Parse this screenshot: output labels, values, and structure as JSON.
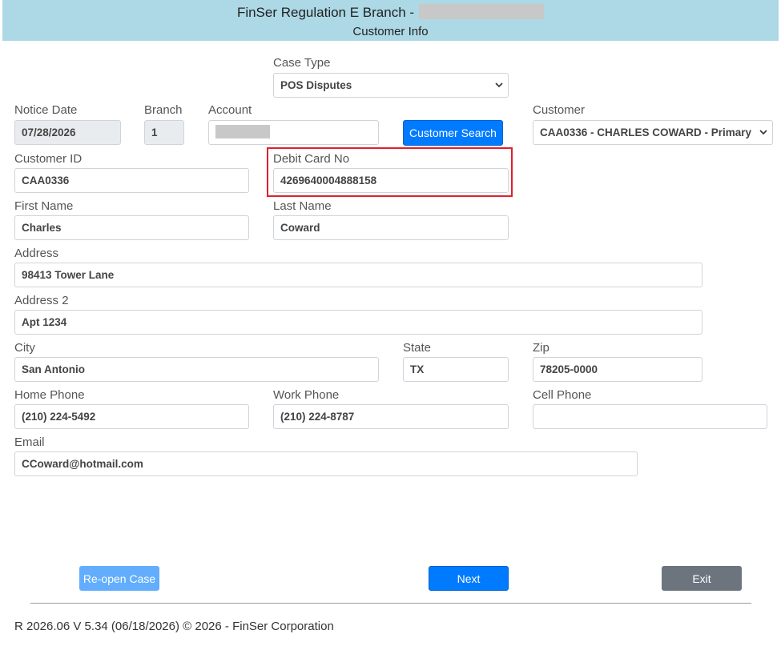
{
  "header": {
    "title": "FinSer Regulation E Branch -",
    "subtitle": "Customer Info"
  },
  "form": {
    "case_type": {
      "label": "Case Type",
      "value": "POS Disputes"
    },
    "notice_date": {
      "label": "Notice Date",
      "value": "07/28/2026"
    },
    "branch": {
      "label": "Branch",
      "value": "1"
    },
    "account": {
      "label": "Account",
      "value": ""
    },
    "customer_search_label": "Customer Search",
    "customer": {
      "label": "Customer",
      "value": "CAA0336 - CHARLES COWARD - Primary"
    },
    "customer_id": {
      "label": "Customer ID",
      "value": "CAA0336"
    },
    "debit_card": {
      "label": "Debit Card No",
      "value": "4269640004888158"
    },
    "first_name": {
      "label": "First Name",
      "value": "Charles"
    },
    "last_name": {
      "label": "Last Name",
      "value": "Coward"
    },
    "address": {
      "label": "Address",
      "value": "98413 Tower Lane"
    },
    "address2": {
      "label": "Address 2",
      "value": "Apt 1234"
    },
    "city": {
      "label": "City",
      "value": "San Antonio"
    },
    "state": {
      "label": "State",
      "value": "TX"
    },
    "zip": {
      "label": "Zip",
      "value": "78205-0000"
    },
    "home_phone": {
      "label": "Home Phone",
      "value": "(210) 224-5492"
    },
    "work_phone": {
      "label": "Work Phone",
      "value": "(210) 224-8787"
    },
    "cell_phone": {
      "label": "Cell Phone",
      "value": ""
    },
    "email": {
      "label": "Email",
      "value": "CCoward@hotmail.com"
    }
  },
  "actions": {
    "reopen_label": "Re-open Case",
    "next_label": "Next",
    "exit_label": "Exit"
  },
  "footer": {
    "text": "R 2026.06 V 5.34 (06/18/2026) © 2026 - FinSer Corporation"
  },
  "colors": {
    "header_bg": "#add8e6",
    "primary": "#007bff",
    "highlight": "#e0202c"
  }
}
